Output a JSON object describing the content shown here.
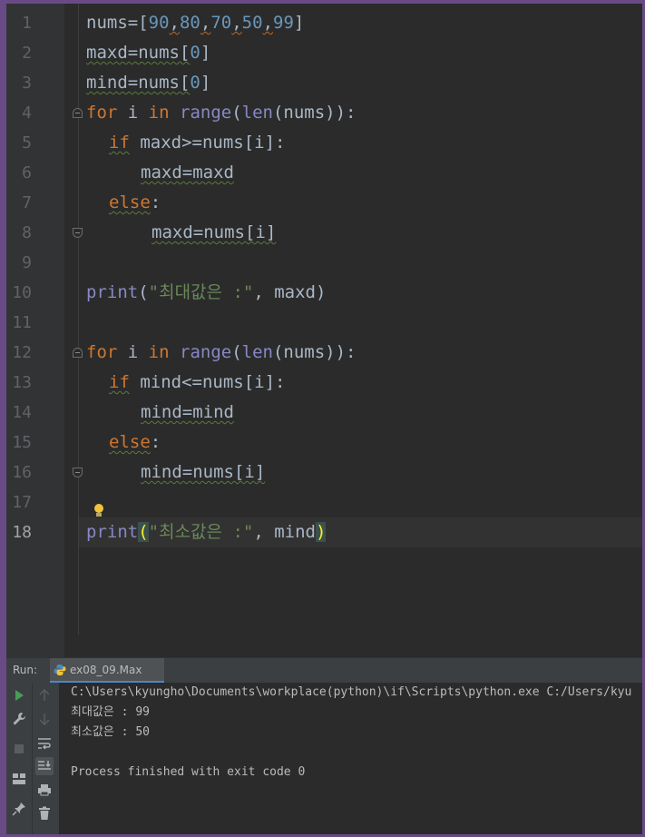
{
  "editor": {
    "line_numbers": [
      "1",
      "2",
      "3",
      "4",
      "5",
      "6",
      "7",
      "8",
      "9",
      "10",
      "11",
      "12",
      "13",
      "14",
      "15",
      "16",
      "17",
      "18"
    ],
    "current_line": "18",
    "code": {
      "l1": {
        "a": "nums=[",
        "n1": "90",
        "c1": ",",
        "n2": "80",
        "c2": ",",
        "n3": "70",
        "c3": ",",
        "n4": "50",
        "c4": ",",
        "n5": "99",
        "b": "]"
      },
      "l2": {
        "a": "maxd=nums[",
        "n": "0",
        "b": "]"
      },
      "l3": {
        "a": "mind=nums[",
        "n": "0",
        "b": "]"
      },
      "l4": {
        "kw1": "for",
        "t1": " i ",
        "kw2": "in",
        "t2": " ",
        "fn1": "range",
        "t3": "(",
        "fn2": "len",
        "t4": "(nums)):"
      },
      "l5": {
        "kw": "if",
        "t": " maxd>=nums[i]:"
      },
      "l6": {
        "t": "maxd=maxd"
      },
      "l7": {
        "kw": "else",
        "t": ":"
      },
      "l8": {
        "t": "maxd=nums[i]"
      },
      "l10": {
        "fn": "print",
        "t1": "(",
        "s": "\"최대값은 :\"",
        "t2": ", maxd)"
      },
      "l12": {
        "kw1": "for",
        "t1": " i ",
        "kw2": "in",
        "t2": " ",
        "fn1": "range",
        "t3": "(",
        "fn2": "len",
        "t4": "(nums)):"
      },
      "l13": {
        "kw": "if",
        "t": " mind<=nums[i]:"
      },
      "l14": {
        "t": "mind=mind"
      },
      "l15": {
        "kw": "else",
        "t": ":"
      },
      "l16": {
        "t": "mind=nums[i]"
      },
      "l18": {
        "fn": "print",
        "p1": "(",
        "s": "\"최소값은 :\"",
        "t2": ", mind",
        "p2": ")"
      }
    }
  },
  "run": {
    "label": "Run:",
    "tab_label": "ex08_09.Max",
    "console": [
      "C:\\Users\\kyungho\\Documents\\workplace(python)\\if\\Scripts\\python.exe C:/Users/kyu",
      "최대값은 : 99",
      "최소값은 : 50",
      "",
      "Process finished with exit code 0"
    ]
  },
  "colors": {
    "editor_bg": "#2b2b2b",
    "keyword": "#cc7832",
    "builtin": "#8888c6",
    "number": "#6897bb",
    "string": "#6a8759",
    "frame": "#6a4a86"
  },
  "icons": [
    "run-icon",
    "wrench-icon",
    "stop-icon",
    "layout-icon",
    "pin-icon",
    "up-arrow-icon",
    "down-arrow-icon",
    "soft-wrap-icon",
    "scroll-to-end-icon",
    "print-icon",
    "trash-icon",
    "python-file-icon",
    "lightbulb-icon"
  ]
}
